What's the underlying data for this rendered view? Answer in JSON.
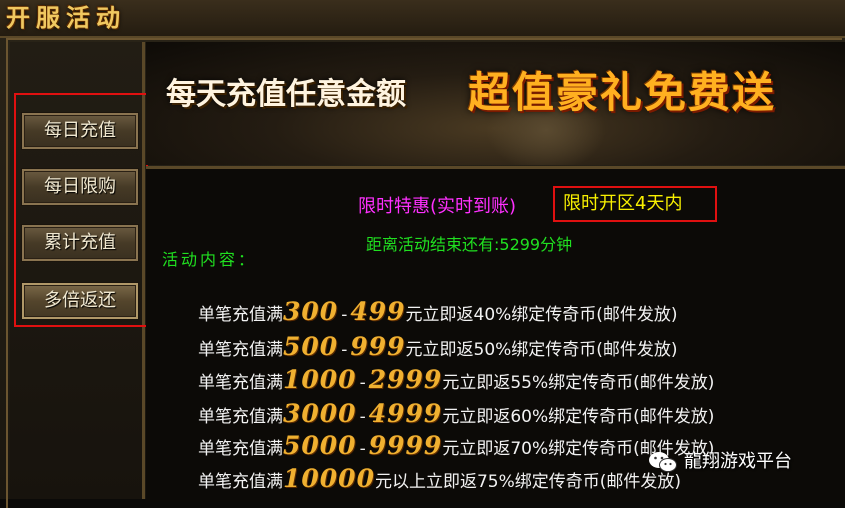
{
  "window": {
    "title": "开服活动"
  },
  "menu": {
    "items": [
      {
        "label": "每日充值"
      },
      {
        "label": "每日限购"
      },
      {
        "label": "累计充值"
      },
      {
        "label": "多倍返还"
      }
    ],
    "active_index": 3
  },
  "banner": {
    "left_text": "每天充值任意金额",
    "right_text": "超值豪礼免费送"
  },
  "info": {
    "promo": "限时特惠(实时到账)",
    "open_period": "限时开区4天内",
    "countdown": "距离活动结束还有:5299分钟",
    "content_label": "活动内容："
  },
  "rules": [
    {
      "prefix": "单笔充值满",
      "from": "300",
      "to": "499",
      "suffix": "元立即返40%绑定传奇币(邮件发放)"
    },
    {
      "prefix": "单笔充值满",
      "from": "500",
      "to": "999",
      "suffix": "元立即返50%绑定传奇币(邮件发放)"
    },
    {
      "prefix": "单笔充值满",
      "from": "1000",
      "to": "2999",
      "suffix": "元立即返55%绑定传奇币(邮件发放)"
    },
    {
      "prefix": "单笔充值满",
      "from": "3000",
      "to": "4999",
      "suffix": "元立即返60%绑定传奇币(邮件发放)"
    },
    {
      "prefix": "单笔充值满",
      "from": "5000",
      "to": "9999",
      "suffix": "元立即返70%绑定传奇币(邮件发放)"
    },
    {
      "prefix": "单笔充值满",
      "from": "10000",
      "to": "",
      "suffix": "元以上立即返75%绑定传奇币(邮件发放)"
    }
  ],
  "watermark": {
    "text": "龍翔游戏平台",
    "icon": "wechat-icon"
  },
  "colors": {
    "title_gold": "#f0c860",
    "promo_magenta": "#ff30ff",
    "highlight_yellow": "#f8f000",
    "countdown_green": "#20e020",
    "number_orange": "#f0b030",
    "annotation_red": "#e01010"
  }
}
